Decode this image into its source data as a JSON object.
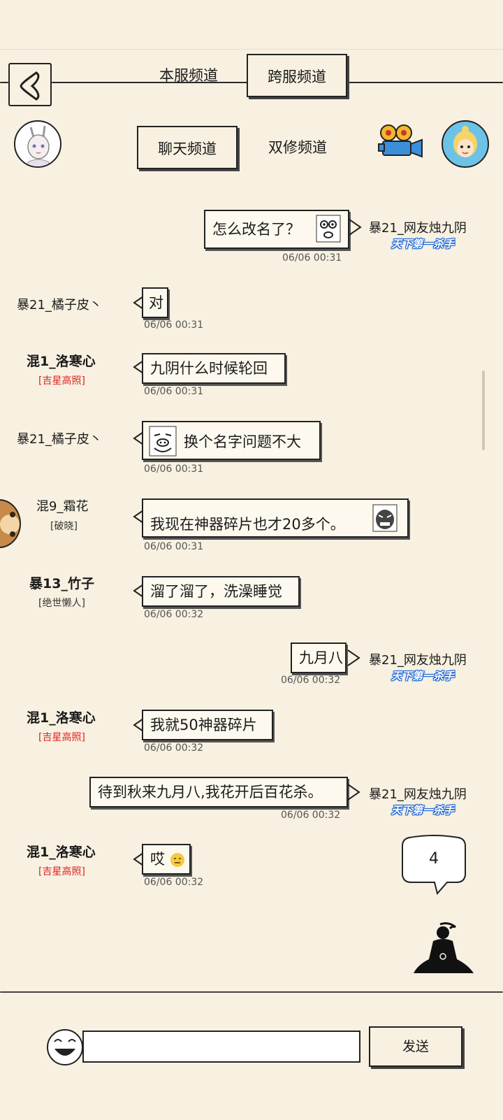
{
  "tabs_top": {
    "local": "本服频道",
    "cross": "跨服频道"
  },
  "tabs_sub": {
    "chat": "聊天频道",
    "cultivate": "双修频道"
  },
  "messages": [
    {
      "side": "right",
      "user": "暴21_网友烛九阴",
      "badge": "天下第一杀手",
      "text": "怎么改名了？",
      "time": "06/06 00:31"
    },
    {
      "side": "left",
      "user": "暴21_橘子皮丶",
      "text": "对",
      "time": "06/06 00:31"
    },
    {
      "side": "left",
      "user": "混1_洛寒心",
      "title": "[吉星高照]",
      "text": "九阴什么时候轮回",
      "time": "06/06 00:31"
    },
    {
      "side": "left",
      "user": "暴21_橘子皮丶",
      "text": "换个名字问题不大",
      "time": "06/06 00:31"
    },
    {
      "side": "left",
      "user": "混9_霜花",
      "title": "[破晓]",
      "text": "我现在神器碎片也才20多个。",
      "time": "06/06 00:31"
    },
    {
      "side": "left",
      "user": "暴13_竹子",
      "title": "[绝世懒人]",
      "text": "溜了溜了，洗澡睡觉",
      "time": "06/06 00:32"
    },
    {
      "side": "right",
      "user": "暴21_网友烛九阴",
      "badge": "天下第一杀手",
      "text": "九月八",
      "time": "06/06 00:32"
    },
    {
      "side": "left",
      "user": "混1_洛寒心",
      "title": "[吉星高照]",
      "text": "我就50神器碎片",
      "time": "06/06 00:32"
    },
    {
      "side": "right",
      "user": "暴21_网友烛九阴",
      "badge": "天下第一杀手",
      "text": "待到秋来九月八,我花开后百花杀。",
      "time": "06/06 00:32"
    },
    {
      "side": "left",
      "user": "混1_洛寒心",
      "title": "[吉星高照]",
      "text": "哎",
      "time": "06/06 00:32"
    }
  ],
  "unread_count": "4",
  "send_label": "发送",
  "input_placeholder": "",
  "colors": {
    "background": "#f8f1e1",
    "title_red": "#dd2222",
    "badge_blue": "#1b64d6"
  }
}
